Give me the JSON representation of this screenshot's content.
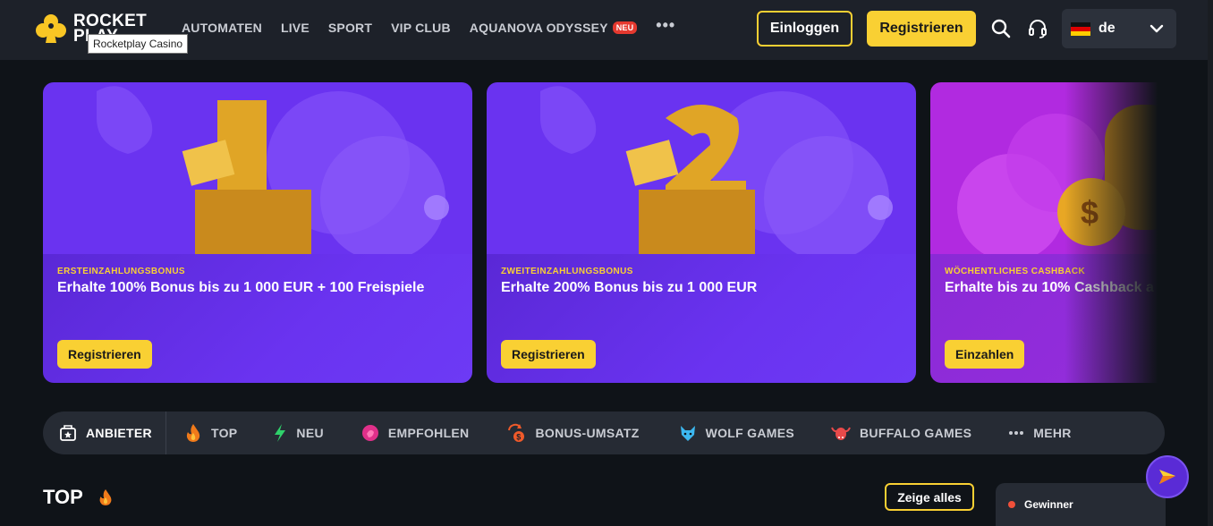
{
  "header": {
    "logo_line1": "ROCKET",
    "logo_line2": "PLAY",
    "tooltip": "Rocketplay Casino",
    "nav": [
      {
        "label": "AUTOMATEN"
      },
      {
        "label": "LIVE"
      },
      {
        "label": "SPORT"
      },
      {
        "label": "VIP CLUB"
      },
      {
        "label": "AQUANOVA ODYSSEY",
        "badge": "NEU"
      }
    ],
    "more": "•••",
    "login": "Einloggen",
    "register": "Registrieren",
    "language": "de"
  },
  "promos": [
    {
      "kicker": "ERSTEINZAHLUNGSBONUS",
      "title": "Erhalte 100% Bonus bis zu 1 000 EUR + 100 Freispiele",
      "button": "Registrieren"
    },
    {
      "kicker": "ZWEITEINZAHLUNGSBONUS",
      "title": "Erhalte 200% Bonus bis zu 1 000 EUR",
      "button": "Registrieren"
    },
    {
      "kicker": "WÖCHENTLICHES CASHBACK",
      "title": "Erhalte bis zu 10% Cashback a",
      "button": "Einzahlen"
    }
  ],
  "categories": [
    {
      "label": "ANBIETER",
      "icon": "star-box-icon"
    },
    {
      "label": "TOP",
      "icon": "fire-icon"
    },
    {
      "label": "NEU",
      "icon": "lightning-icon"
    },
    {
      "label": "EMPFOHLEN",
      "icon": "recommended-icon"
    },
    {
      "label": "BONUS-UMSATZ",
      "icon": "bonus-wager-icon"
    },
    {
      "label": "WOLF GAMES",
      "icon": "wolf-icon"
    },
    {
      "label": "BUFFALO GAMES",
      "icon": "buffalo-icon"
    },
    {
      "label": "MEHR",
      "icon": "more-dots-icon"
    }
  ],
  "section": {
    "title": "TOP",
    "show_all": "Zeige alles"
  },
  "winners": {
    "label": "Gewinner"
  },
  "colors": {
    "accent": "#f9d033",
    "header_bg": "#1d2129",
    "page_bg": "#0f1318"
  }
}
